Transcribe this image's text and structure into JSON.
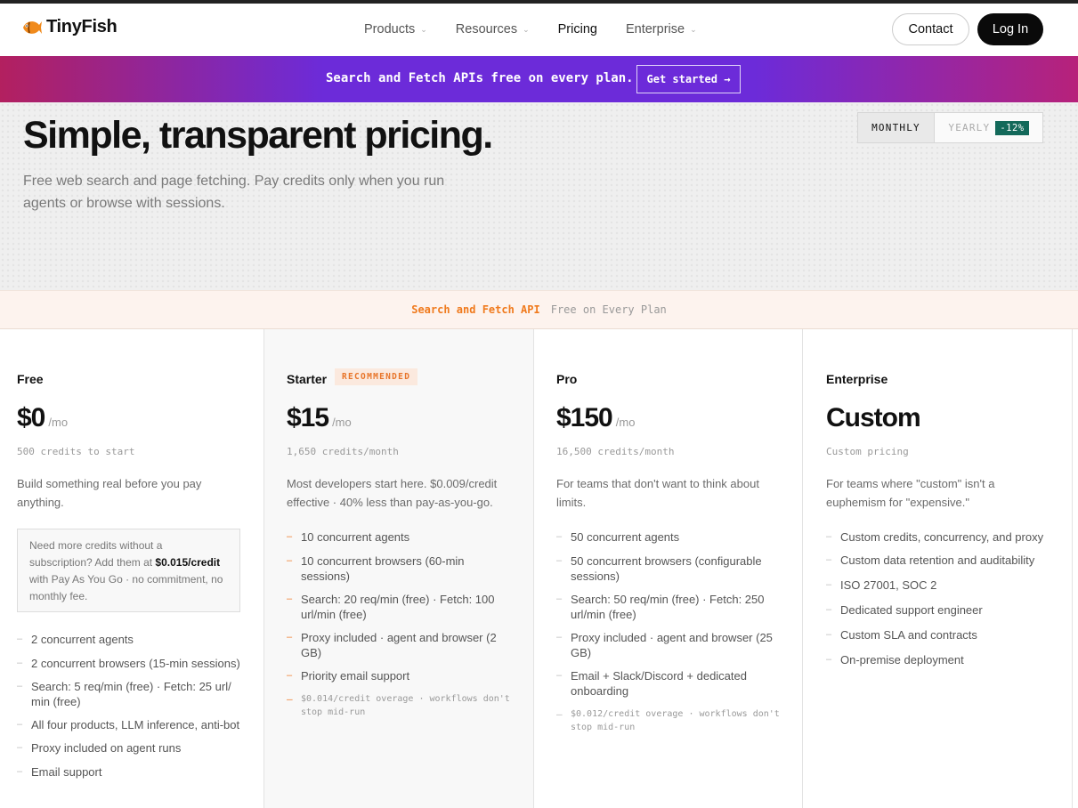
{
  "nav": {
    "brand": "TinyFish",
    "links": [
      {
        "label": "Products",
        "dropdown": true
      },
      {
        "label": "Resources",
        "dropdown": true
      },
      {
        "label": "Pricing",
        "dropdown": false
      },
      {
        "label": "Enterprise",
        "dropdown": true
      }
    ],
    "chevron": "⌄",
    "contact": "Contact",
    "login": "Log In"
  },
  "banner": {
    "text": "Search and Fetch APIs free on every plan.",
    "button": "Get started →"
  },
  "hero": {
    "title": "Simple, transparent pricing.",
    "subtitle": "Free web search and page fetching. Pay credits only when you run agents or browse with sessions.",
    "toggle": {
      "monthly": "MONTHLY",
      "yearly": "YEARLY",
      "discount": "-12%"
    }
  },
  "strip": {
    "highlight": "Search and Fetch API",
    "text": "Free on Every Plan"
  },
  "plans": [
    {
      "name": "Free",
      "price": "$0",
      "unit": "/mo",
      "credits": "500 credits to start",
      "description": "Build something real before you pay anything.",
      "note": {
        "pre": "Need more credits without a subscription? Add them at ",
        "price": "$0.015/credit",
        "post": " with Pay As You Go · no commitment, no monthly fee."
      },
      "features": [
        "2 concurrent agents",
        "2 concurrent browsers (15-min sessions)",
        "Search: 5 req/min (free) · Fetch: 25 url/ min (free)",
        "All four products, LLM inference, anti-bot",
        "Proxy included on agent runs",
        "Email support"
      ]
    },
    {
      "name": "Starter",
      "badge": "RECOMMENDED",
      "price": "$15",
      "unit": "/mo",
      "credits": "1,650 credits/month",
      "description": "Most developers start here. $0.009/credit effective · 40% less than pay-as-you-go.",
      "features": [
        "10 concurrent agents",
        "10 concurrent browsers (60-min sessions)",
        "Search: 20 req/min (free) · Fetch: 100 url/min (free)",
        "Proxy included · agent and browser (2 GB)",
        "Priority email support"
      ],
      "footnote": "$0.014/credit overage · workflows don't stop mid-run"
    },
    {
      "name": "Pro",
      "price": "$150",
      "unit": "/mo",
      "credits": "16,500 credits/month",
      "description": "For teams that don't want to think about limits.",
      "features": [
        "50 concurrent agents",
        "50 concurrent browsers (configurable sessions)",
        "Search: 50 req/min (free) · Fetch: 250 url/min (free)",
        "Proxy included · agent and browser (25 GB)",
        "Email + Slack/Discord + dedicated onboarding"
      ],
      "footnote": "$0.012/credit overage · workflows don't stop mid-run"
    },
    {
      "name": "Enterprise",
      "price": "Custom",
      "credits": "Custom pricing",
      "description": "For teams where \"custom\" isn't a euphemism for \"expensive.\"",
      "features": [
        "Custom credits, concurrency, and proxy",
        "Custom data retention and auditability",
        "ISO 27001, SOC 2",
        "Dedicated support engineer",
        "Custom SLA and contracts",
        "On-premise deployment"
      ]
    }
  ],
  "colors": {
    "accent_orange": "#f07a1d",
    "banner_purple": "#6c2bd9",
    "banner_magenta": "#b3205f",
    "discount_green": "#13695a"
  }
}
